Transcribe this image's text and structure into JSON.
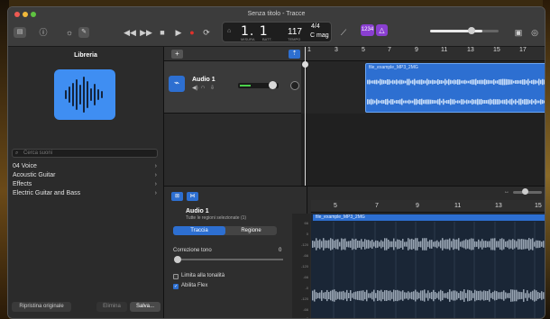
{
  "window": {
    "title": "Senza titolo - Tracce"
  },
  "lcd": {
    "position": "1. 1",
    "pos_sub1": "MISURA",
    "pos_sub2": "BATT.",
    "tempo": "117",
    "tempo_label": "TEMPO",
    "signature": "4/4",
    "key": "C mag"
  },
  "toolbar": {
    "count_in": "1234",
    "tuner": "♪"
  },
  "library": {
    "title": "Libreria",
    "search_placeholder": "Cerca suoni",
    "items": [
      "04 Voice",
      "Acoustic Guitar",
      "Effects",
      "Electric Guitar and Bass"
    ],
    "restore_button": "Ripristina originale",
    "delete_button": "Elimina",
    "save_button": "Salva..."
  },
  "track": {
    "name": "Audio 1"
  },
  "ruler": {
    "ticks": [
      "1",
      "3",
      "5",
      "7",
      "9",
      "11",
      "13",
      "15",
      "17"
    ]
  },
  "region": {
    "name": "file_example_MP3_2MG"
  },
  "editor": {
    "track_name": "Audio 1",
    "subtitle": "Tutte le regioni selezionate (1)",
    "tab_track": "Traccia",
    "tab_region": "Regione",
    "pitch_label": "Correzione tono",
    "pitch_value": "0",
    "limit_label": "Limita alla tonalità",
    "flex_label": "Abilita Flex",
    "ticks": [
      "5",
      "7",
      "9",
      "11",
      "13",
      "15"
    ],
    "region_name": "file_example_MP3_2MG",
    "db_labels": [
      "66",
      "0",
      "-120",
      "-66",
      "-120",
      "-66",
      "-0",
      "-120",
      "-66",
      "0"
    ]
  },
  "colors": {
    "accent": "#2d6fd1",
    "purple": "#8a3fd1",
    "record": "#e0312b"
  }
}
